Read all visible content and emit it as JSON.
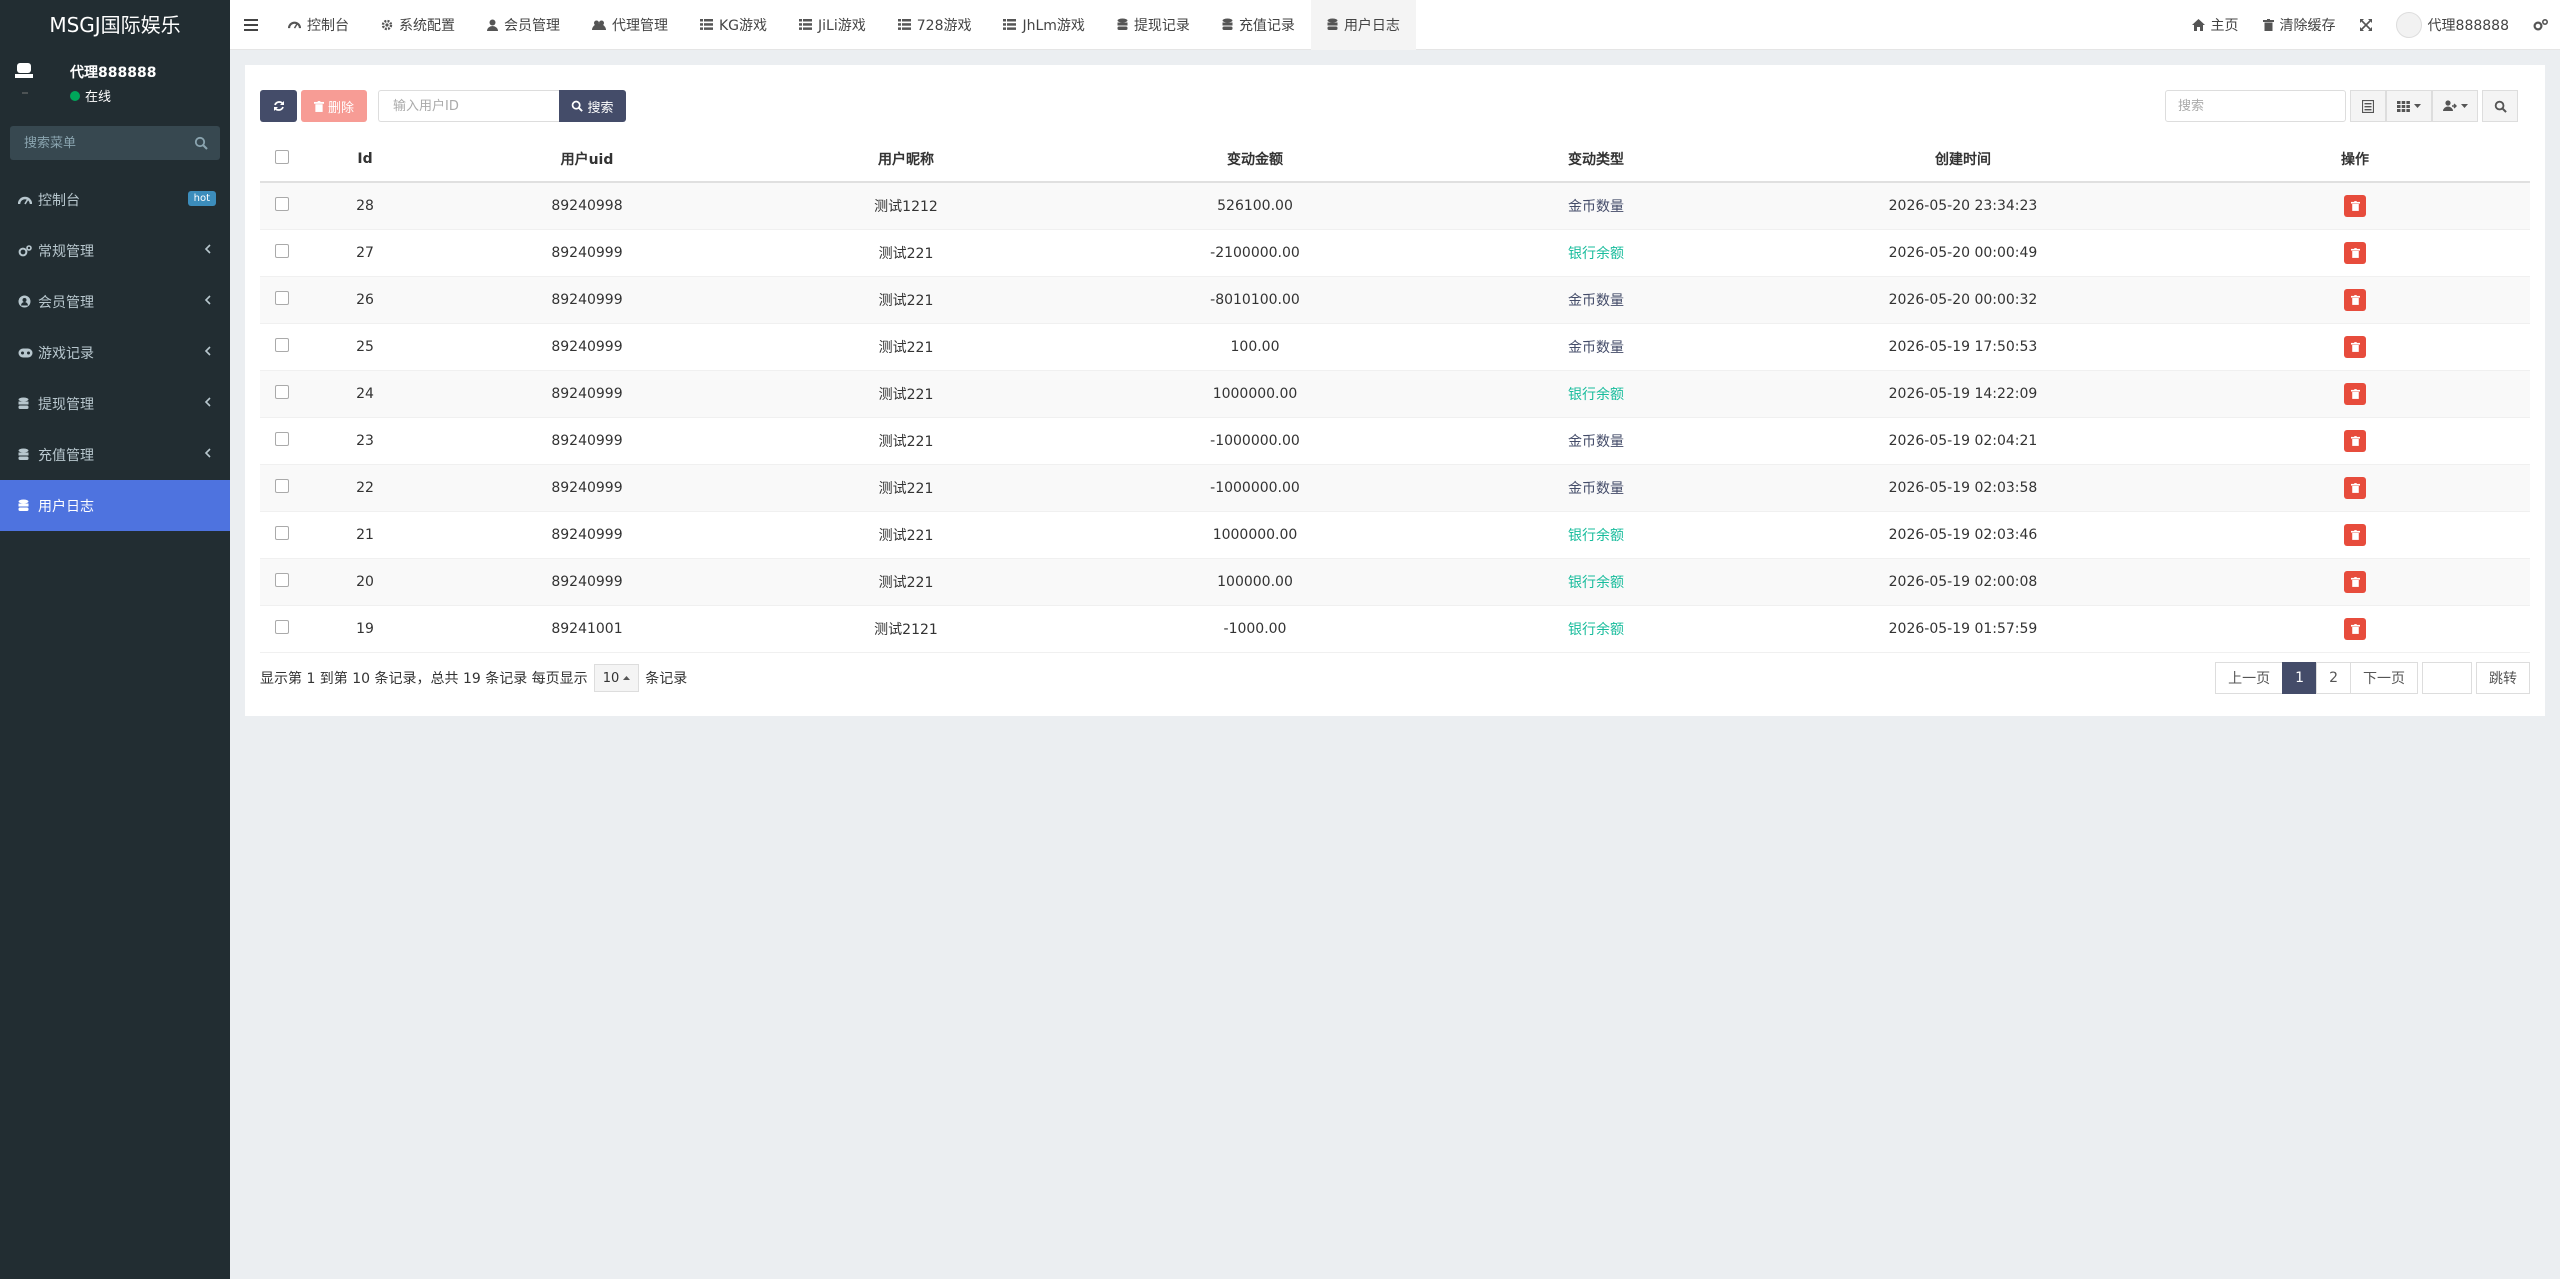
{
  "app": {
    "title": "MSGJ国际娱乐"
  },
  "user": {
    "name": "代理888888",
    "status": "在线"
  },
  "sidebar": {
    "search_placeholder": "搜索菜单",
    "items": [
      {
        "label": "控制台",
        "icon": "dashboard-icon",
        "badge": "hot"
      },
      {
        "label": "常规管理",
        "icon": "cogs-icon"
      },
      {
        "label": "会员管理",
        "icon": "user-circle-icon"
      },
      {
        "label": "游戏记录",
        "icon": "gamepad-icon"
      },
      {
        "label": "提现管理",
        "icon": "database-icon"
      },
      {
        "label": "充值管理",
        "icon": "database-icon"
      },
      {
        "label": "用户日志",
        "icon": "database-icon",
        "active": true
      }
    ]
  },
  "topnav": {
    "tabs": [
      {
        "label": "控制台",
        "icon": "dashboard-icon"
      },
      {
        "label": "系统配置",
        "icon": "gear-icon"
      },
      {
        "label": "会员管理",
        "icon": "user-icon"
      },
      {
        "label": "代理管理",
        "icon": "users-icon"
      },
      {
        "label": "KG游戏",
        "icon": "list-icon"
      },
      {
        "label": "JiLi游戏",
        "icon": "list-icon"
      },
      {
        "label": "728游戏",
        "icon": "list-icon"
      },
      {
        "label": "JhLm游戏",
        "icon": "list-icon"
      },
      {
        "label": "提现记录",
        "icon": "database-icon"
      },
      {
        "label": "充值记录",
        "icon": "database-icon"
      },
      {
        "label": "用户日志",
        "icon": "database-icon",
        "active": true
      }
    ],
    "home": "主页",
    "clear_cache": "清除缓存",
    "user": "代理888888"
  },
  "toolbar": {
    "delete_label": "删除",
    "uid_placeholder": "输入用户ID",
    "search_label": "搜索",
    "right_search_placeholder": "搜索"
  },
  "table": {
    "columns": [
      "Id",
      "用户uid",
      "用户昵称",
      "变动金额",
      "变动类型",
      "创建时间",
      "操作"
    ],
    "rows": [
      {
        "id": "28",
        "uid": "89240998",
        "nick": "测试1212",
        "amount": "526100.00",
        "type": "金币数量",
        "time": "2026-05-20 23:34:23"
      },
      {
        "id": "27",
        "uid": "89240999",
        "nick": "测试221",
        "amount": "-2100000.00",
        "type": "银行余额",
        "time": "2026-05-20 00:00:49"
      },
      {
        "id": "26",
        "uid": "89240999",
        "nick": "测试221",
        "amount": "-8010100.00",
        "type": "金币数量",
        "time": "2026-05-20 00:00:32"
      },
      {
        "id": "25",
        "uid": "89240999",
        "nick": "测试221",
        "amount": "100.00",
        "type": "金币数量",
        "time": "2026-05-19 17:50:53"
      },
      {
        "id": "24",
        "uid": "89240999",
        "nick": "测试221",
        "amount": "1000000.00",
        "type": "银行余额",
        "time": "2026-05-19 14:22:09"
      },
      {
        "id": "23",
        "uid": "89240999",
        "nick": "测试221",
        "amount": "-1000000.00",
        "type": "金币数量",
        "time": "2026-05-19 02:04:21"
      },
      {
        "id": "22",
        "uid": "89240999",
        "nick": "测试221",
        "amount": "-1000000.00",
        "type": "金币数量",
        "time": "2026-05-19 02:03:58"
      },
      {
        "id": "21",
        "uid": "89240999",
        "nick": "测试221",
        "amount": "1000000.00",
        "type": "银行余额",
        "time": "2026-05-19 02:03:46"
      },
      {
        "id": "20",
        "uid": "89240999",
        "nick": "测试221",
        "amount": "100000.00",
        "type": "银行余额",
        "time": "2026-05-19 02:00:08"
      },
      {
        "id": "19",
        "uid": "89241001",
        "nick": "测试2121",
        "amount": "-1000.00",
        "type": "银行余额",
        "time": "2026-05-19 01:57:59"
      }
    ]
  },
  "footer": {
    "info_prefix": "显示第 1 到第 10 条记录，总共 19 条记录 每页显示",
    "page_size": "10",
    "info_suffix": "条记录",
    "prev": "上一页",
    "pages": [
      "1",
      "2"
    ],
    "next": "下一页",
    "jump": "跳转"
  },
  "colors": {
    "sidebar_bg": "#222d32",
    "active_menu": "#4e73df",
    "primary_button": "#444c69",
    "danger": "#e74c3c",
    "bank_type": "#18bc9c",
    "online": "#00a65a"
  }
}
